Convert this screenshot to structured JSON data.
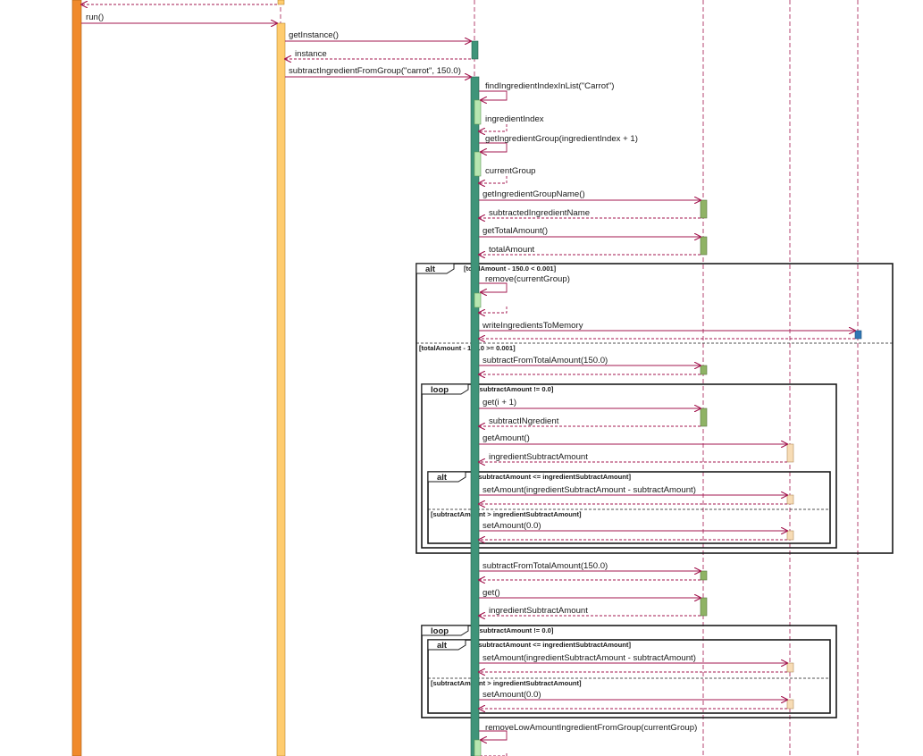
{
  "diagram": {
    "type": "sequence",
    "colors": {
      "message": "#a3174f",
      "lifeline": "#a3174f",
      "frame": "#1a1a1a",
      "act_orange": "#f08a2c",
      "act_light_orange": "#ffcc6e",
      "act_teal": "#3f9479",
      "act_light_green": "#b8e6b0",
      "act_olive": "#8fb365",
      "act_peach": "#f7dcb5",
      "act_blue": "#2f77b5"
    },
    "messages": [
      {
        "label": "run()"
      },
      {
        "label": "getInstance()"
      },
      {
        "label": "instance"
      },
      {
        "label": "subtractIngredientFromGroup(\"carrot\", 150.0)"
      },
      {
        "label": "findIngredientIndexInList(\"Carrot\")"
      },
      {
        "label": "ingredientIndex"
      },
      {
        "label": "getIngredientGroup(ingredientIndex + 1)"
      },
      {
        "label": "currentGroup"
      },
      {
        "label": "getIngredientGroupName()"
      },
      {
        "label": "subtractedIngredientName"
      },
      {
        "label": "getTotalAmount()"
      },
      {
        "label": "totalAmount"
      },
      {
        "label": "remove(currentGroup)"
      },
      {
        "label": "writeIngredientsToMemory"
      },
      {
        "label": "subtractFromTotalAmount(150.0)"
      },
      {
        "label": "get(i + 1)"
      },
      {
        "label": "subtractINgredient"
      },
      {
        "label": "getAmount()"
      },
      {
        "label": "ingredientSubtractAmount"
      },
      {
        "label": "setAmount(ingredientSubtractAmount - subtractAmount)"
      },
      {
        "label": "setAmount(0.0)"
      },
      {
        "label": "subtractFromTotalAmount(150.0)"
      },
      {
        "label": "get()"
      },
      {
        "label": "ingredientSubtractAmount"
      },
      {
        "label": "setAmount(ingredientSubtractAmount - subtractAmount)"
      },
      {
        "label": "setAmount(0.0)"
      },
      {
        "label": "removeLowAmountIngredientFromGroup(currentGroup)"
      }
    ],
    "fragments": [
      {
        "kind": "alt",
        "guards": [
          "[totalAmount - 150.0 < 0.001]",
          "[totalAmount - 150.0 >= 0.001]"
        ]
      },
      {
        "kind": "loop",
        "guards": [
          "[subtractAmount != 0.0]"
        ]
      },
      {
        "kind": "alt",
        "guards": [
          "[subtractAmount <= ingredientSubtractAmount]",
          "[subtractAmount > ingredientSubtractAmount]"
        ]
      },
      {
        "kind": "loop",
        "guards": [
          "[subtractAmount != 0.0]"
        ]
      },
      {
        "kind": "alt",
        "guards": [
          "[subtractAmount <= ingredientSubtractAmount]",
          "[subtractAmount > ingredientSubtractAmount]"
        ]
      }
    ]
  }
}
